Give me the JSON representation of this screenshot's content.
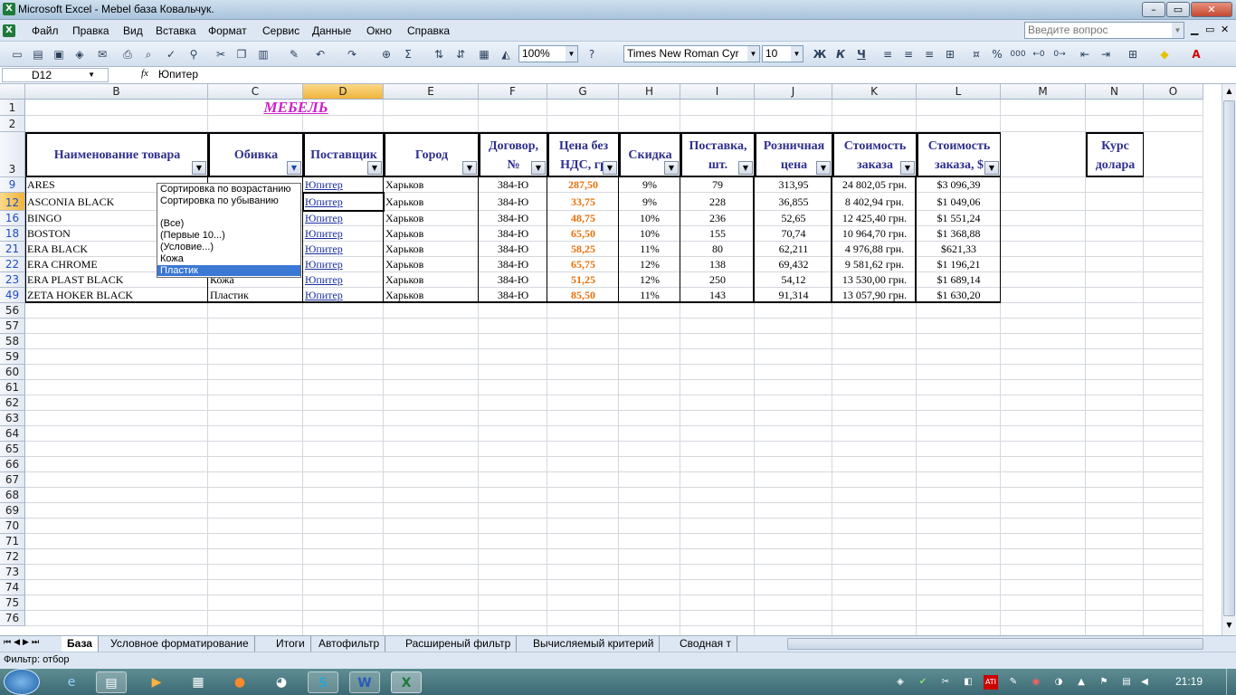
{
  "window": {
    "title": "Microsoft Excel - Mebel база Ковальчук.",
    "doc_min": "▁",
    "doc_restore": "▭",
    "doc_close": "✕",
    "min": "–",
    "restore": "▭",
    "close": "✕"
  },
  "menu": {
    "items": [
      "Файл",
      "Правка",
      "Вид",
      "Вставка",
      "Формат",
      "Сервис",
      "Данные",
      "Окно",
      "Справка"
    ],
    "help_placeholder": "Введите вопрос"
  },
  "toolbar": {
    "zoom": "100%",
    "font": "Times New Roman Cyr",
    "size": "10",
    "bold": "Ж",
    "italic": "К",
    "underline": "Ч",
    "percent": "%",
    "thousands": "000"
  },
  "formula": {
    "namebox": "D12",
    "fx": "fx",
    "content": "Юпитер"
  },
  "columns": [
    "B",
    "C",
    "D",
    "E",
    "F",
    "G",
    "H",
    "I",
    "J",
    "K",
    "L",
    "M",
    "N",
    "O"
  ],
  "title": "МЕБЕЛЬ",
  "headers": {
    "B": "Наименование товара",
    "C": "Обивка",
    "D": "Поставщик",
    "E": "Город",
    "F1": "Договор,",
    "F2": "№",
    "G1": "Цена без",
    "G2": "НДС, гр",
    "H": "Скидка",
    "I1": "Поставка,",
    "I2": "шт.",
    "J1": "Розничная",
    "J2": "цена",
    "K1": "Стоимость",
    "K2": "заказа",
    "L1": "Стоимость",
    "L2": "заказа, $",
    "N1": "Курс",
    "N2": "долара"
  },
  "rows": [
    {
      "num": "9",
      "name": "ARES",
      "upholstery": "",
      "supplier": "Юпитер",
      "city": "Харьков",
      "contract": "384-Ю",
      "price": "287,50",
      "discount": "9%",
      "qty": "79",
      "retail": "313,95",
      "cost_uah": "24 802,05 грн.",
      "cost_usd": "$3 096,39"
    },
    {
      "num": "12",
      "name": "ASCONIA BLACK",
      "upholstery": "",
      "supplier": "Юпитер",
      "city": "Харьков",
      "contract": "384-Ю",
      "price": "33,75",
      "discount": "9%",
      "qty": "228",
      "retail": "36,855",
      "cost_uah": "8 402,94 грн.",
      "cost_usd": "$1 049,06"
    },
    {
      "num": "16",
      "name": "BINGO",
      "upholstery": "",
      "supplier": "Юпитер",
      "city": "Харьков",
      "contract": "384-Ю",
      "price": "48,75",
      "discount": "10%",
      "qty": "236",
      "retail": "52,65",
      "cost_uah": "12 425,40 грн.",
      "cost_usd": "$1 551,24"
    },
    {
      "num": "18",
      "name": "BOSTON",
      "upholstery": "",
      "supplier": "Юпитер",
      "city": "Харьков",
      "contract": "384-Ю",
      "price": "65,50",
      "discount": "10%",
      "qty": "155",
      "retail": "70,74",
      "cost_uah": "10 964,70 грн.",
      "cost_usd": "$1 368,88"
    },
    {
      "num": "21",
      "name": "ERA BLACK",
      "upholstery": "",
      "supplier": "Юпитер",
      "city": "Харьков",
      "contract": "384-Ю",
      "price": "58,25",
      "discount": "11%",
      "qty": "80",
      "retail": "62,211",
      "cost_uah": "4 976,88 грн.",
      "cost_usd": "$621,33"
    },
    {
      "num": "22",
      "name": "ERA CHROME",
      "upholstery": "Кожа",
      "supplier": "Юпитер",
      "city": "Харьков",
      "contract": "384-Ю",
      "price": "65,75",
      "discount": "12%",
      "qty": "138",
      "retail": "69,432",
      "cost_uah": "9 581,62 грн.",
      "cost_usd": "$1 196,21"
    },
    {
      "num": "23",
      "name": "ERA PLAST BLACK",
      "upholstery": "Кожа",
      "supplier": "Юпитер",
      "city": "Харьков",
      "contract": "384-Ю",
      "price": "51,25",
      "discount": "12%",
      "qty": "250",
      "retail": "54,12",
      "cost_uah": "13 530,00 грн.",
      "cost_usd": "$1 689,14"
    },
    {
      "num": "49",
      "name": "ZETA HOKER BLACK",
      "upholstery": "Пластик",
      "supplier": "Юпитер",
      "city": "Харьков",
      "contract": "384-Ю",
      "price": "85,50",
      "discount": "11%",
      "qty": "143",
      "retail": "91,314",
      "cost_uah": "13 057,90 грн.",
      "cost_usd": "$1 630,20"
    }
  ],
  "empty_rows": [
    "56",
    "57",
    "58",
    "59",
    "60",
    "61",
    "62",
    "63",
    "64",
    "65",
    "66",
    "67",
    "68",
    "69",
    "70",
    "71",
    "72",
    "73",
    "74",
    "75",
    "76"
  ],
  "top_rows": [
    "1",
    "2",
    "3"
  ],
  "dropdown": [
    "Сортировка по возрастанию",
    "Сортировка по убыванию",
    "",
    "(Все)",
    "(Первые 10...)",
    "(Условие...)",
    "Кожа",
    "Пластик"
  ],
  "sheets": [
    "База",
    "Условное форматирование",
    "Итоги",
    "Автофильтр",
    "Расширеный фильтр",
    "Вычисляемый критерий",
    "Сводная т"
  ],
  "status": "Фильтр: отбор",
  "clock": "21:19",
  "colors": {
    "header_text": "#2f2f8f",
    "price": "#e8700a",
    "supplier": "#1a2f9f",
    "title": "#cc22cc"
  }
}
